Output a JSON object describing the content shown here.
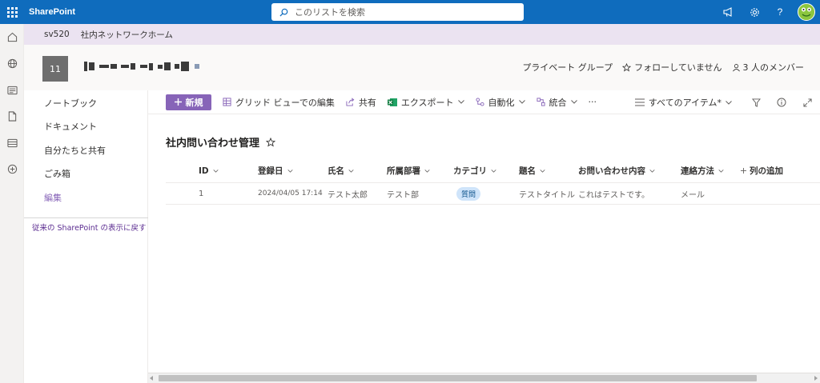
{
  "suitebar": {
    "brand": "SharePoint",
    "search_placeholder": "このリストを検索"
  },
  "hub": {
    "site_code": "sv520",
    "hub_name": "社内ネットワークホーム"
  },
  "site": {
    "logo_text": "11",
    "privacy": "プライベート グループ",
    "follow": "フォローしていません",
    "members": "3 人のメンバー"
  },
  "nav": {
    "items": [
      {
        "label": "ノートブック"
      },
      {
        "label": "ドキュメント"
      },
      {
        "label": "自分たちと共有"
      },
      {
        "label": "ごみ箱"
      },
      {
        "label": "編集"
      }
    ],
    "classic_link": "従来の SharePoint の表示に戻す"
  },
  "commands": {
    "new": "新規",
    "grid_edit": "グリッド ビューでの編集",
    "share": "共有",
    "export": "エクスポート",
    "automate": "自動化",
    "integrate": "統合",
    "more": "···",
    "view": "すべてのアイテム*"
  },
  "list": {
    "title": "社内問い合わせ管理",
    "columns": [
      "ID",
      "登録日",
      "氏名",
      "所属部署",
      "カテゴリ",
      "題名",
      "お問い合わせ内容",
      "連絡方法",
      "列の追加"
    ],
    "rows": [
      {
        "id": "1",
        "date": "2024/04/05 17:14",
        "name": "テスト太郎",
        "dept": "テスト部",
        "category": "質問",
        "subject": "テストタイトル",
        "content": "これはテストです。",
        "contact": "メール"
      }
    ]
  },
  "colors": {
    "suitebar": "#0f6cbd",
    "accent": "#8764b8",
    "hub": "#ebe3f1"
  }
}
